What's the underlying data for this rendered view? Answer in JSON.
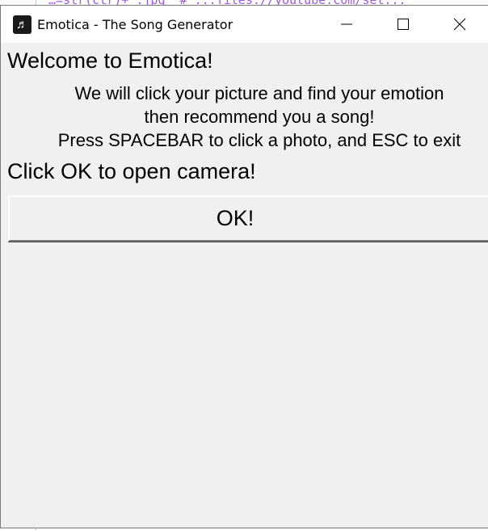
{
  "backdrop": {
    "code_fragment": "…=str(ctr)+\".jpg\"  #  ...files://youtube.com/sel..."
  },
  "window": {
    "title": "Emotica - The Song Generator",
    "icon": "music-note-icon",
    "controls": {
      "minimize": "minimize-icon",
      "maximize": "maximize-icon",
      "close": "close-icon"
    }
  },
  "content": {
    "welcome": "Welcome to Emotica!",
    "description": [
      "We will click your picture and find your emotion",
      "then recommend you a song!",
      "Press SPACEBAR to click a photo, and ESC to exit"
    ],
    "prompt": "Click OK to open camera!",
    "ok_label": "OK!"
  },
  "colors": {
    "window_bg": "#f0f0f0",
    "titlebar_bg": "#ffffff",
    "text": "#000000"
  }
}
